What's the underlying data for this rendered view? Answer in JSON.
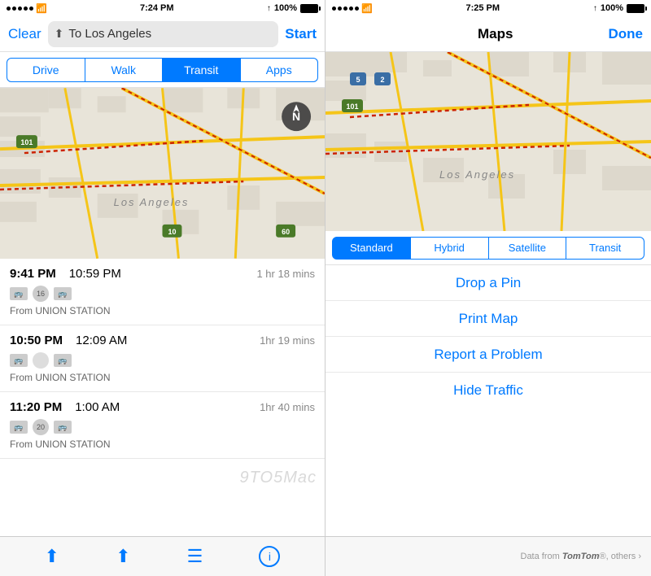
{
  "left": {
    "statusBar": {
      "time": "7:24 PM",
      "signal": "100%",
      "battery": "100%"
    },
    "nav": {
      "clear": "Clear",
      "destination": "To Los Angeles",
      "start": "Start"
    },
    "segments": [
      "Drive",
      "Walk",
      "Transit",
      "Apps"
    ],
    "activeSegment": 2,
    "transitItems": [
      {
        "depart": "9:41 PM",
        "arrive": "10:59 PM",
        "duration": "1 hr 18 mins",
        "from": "From UNION STATION",
        "badge": "16"
      },
      {
        "depart": "10:50 PM",
        "arrive": "12:09 AM",
        "duration": "1hr 19 mins",
        "from": "From UNION STATION",
        "badge": ""
      },
      {
        "depart": "11:20 PM",
        "arrive": "1:00 AM",
        "duration": "1hr 40 mins",
        "from": "From UNION STATION",
        "badge": "20"
      }
    ],
    "watermark": "9TO5Mac",
    "toolbar": {
      "location": "⬆",
      "share": "⬆",
      "list": "☰",
      "info": "ℹ"
    }
  },
  "right": {
    "statusBar": {
      "time": "7:25 PM",
      "signal": "100%"
    },
    "header": {
      "title": "Maps",
      "done": "Done"
    },
    "mapSegments": [
      "Standard",
      "Hybrid",
      "Satellite",
      "Transit"
    ],
    "activeMapSegment": 0,
    "options": [
      "Drop a Pin",
      "Print Map",
      "Report a Problem",
      "Hide Traffic"
    ],
    "attribution": "Data from TomTom, others ›"
  }
}
